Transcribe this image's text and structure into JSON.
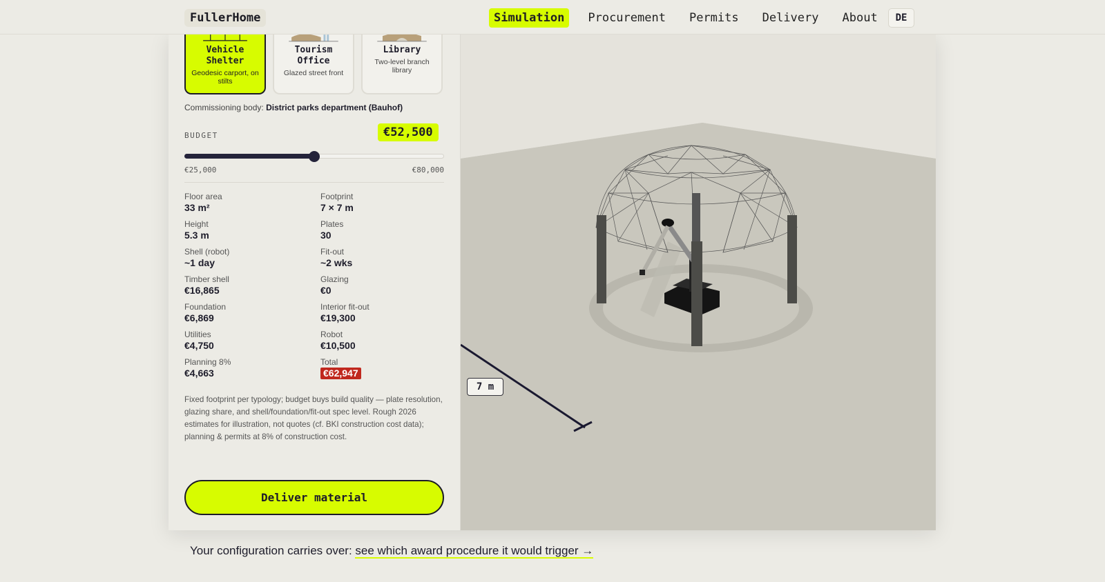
{
  "nav": {
    "logo": "FullerHome",
    "items": [
      "Simulation",
      "Procurement",
      "Permits",
      "Delivery",
      "About"
    ],
    "active": "Simulation",
    "lang": "DE"
  },
  "typologies": [
    {
      "name": "Vehicle Shelter",
      "desc": "Geodesic carport, on stilts",
      "selected": true
    },
    {
      "name": "Tourism Office",
      "desc": "Glazed street front",
      "selected": false
    },
    {
      "name": "Library",
      "desc": "Two-level branch library",
      "selected": false
    }
  ],
  "commission": {
    "label": "Commissioning body:",
    "value": "District parks department (Bauhof)"
  },
  "budget": {
    "label": "BUDGET",
    "value": "€52,500",
    "min_label": "€25,000",
    "max_label": "€80,000",
    "min": 25000,
    "max": 80000,
    "current": 52500
  },
  "stats": [
    {
      "label": "Floor area",
      "value": "33 m²"
    },
    {
      "label": "Footprint",
      "value": "7 × 7 m"
    },
    {
      "label": "Height",
      "value": "5.3 m"
    },
    {
      "label": "Plates",
      "value": "30"
    },
    {
      "label": "Shell (robot)",
      "value": "~1 day"
    },
    {
      "label": "Fit-out",
      "value": "~2 wks"
    },
    {
      "label": "Timber shell",
      "value": "€16,865"
    },
    {
      "label": "Glazing",
      "value": "€0"
    },
    {
      "label": "Foundation",
      "value": "€6,869"
    },
    {
      "label": "Interior fit-out",
      "value": "€19,300"
    },
    {
      "label": "Utilities",
      "value": "€4,750"
    },
    {
      "label": "Robot",
      "value": "€10,500"
    },
    {
      "label": "Planning 8%",
      "value": "€4,663"
    },
    {
      "label": "Total",
      "value": "€62,947"
    }
  ],
  "note": "Fixed footprint per typology; budget buys build quality — plate resolution, glazing share, and shell/foundation/fit-out spec level. Rough 2026 estimates for illustration, not quotes (cf. BKI construction cost data); planning & permits at 8% of construction cost.",
  "deliver_button": "Deliver material",
  "scene": {
    "scale_label": "7 m"
  },
  "footer": {
    "text": "Your configuration carries over: ",
    "link": "see which award procedure it would trigger →"
  },
  "colors": {
    "accent": "#d7fc00",
    "dark": "#1c1b26",
    "total_badge": "#c0281e",
    "background": "#ecebe5"
  }
}
